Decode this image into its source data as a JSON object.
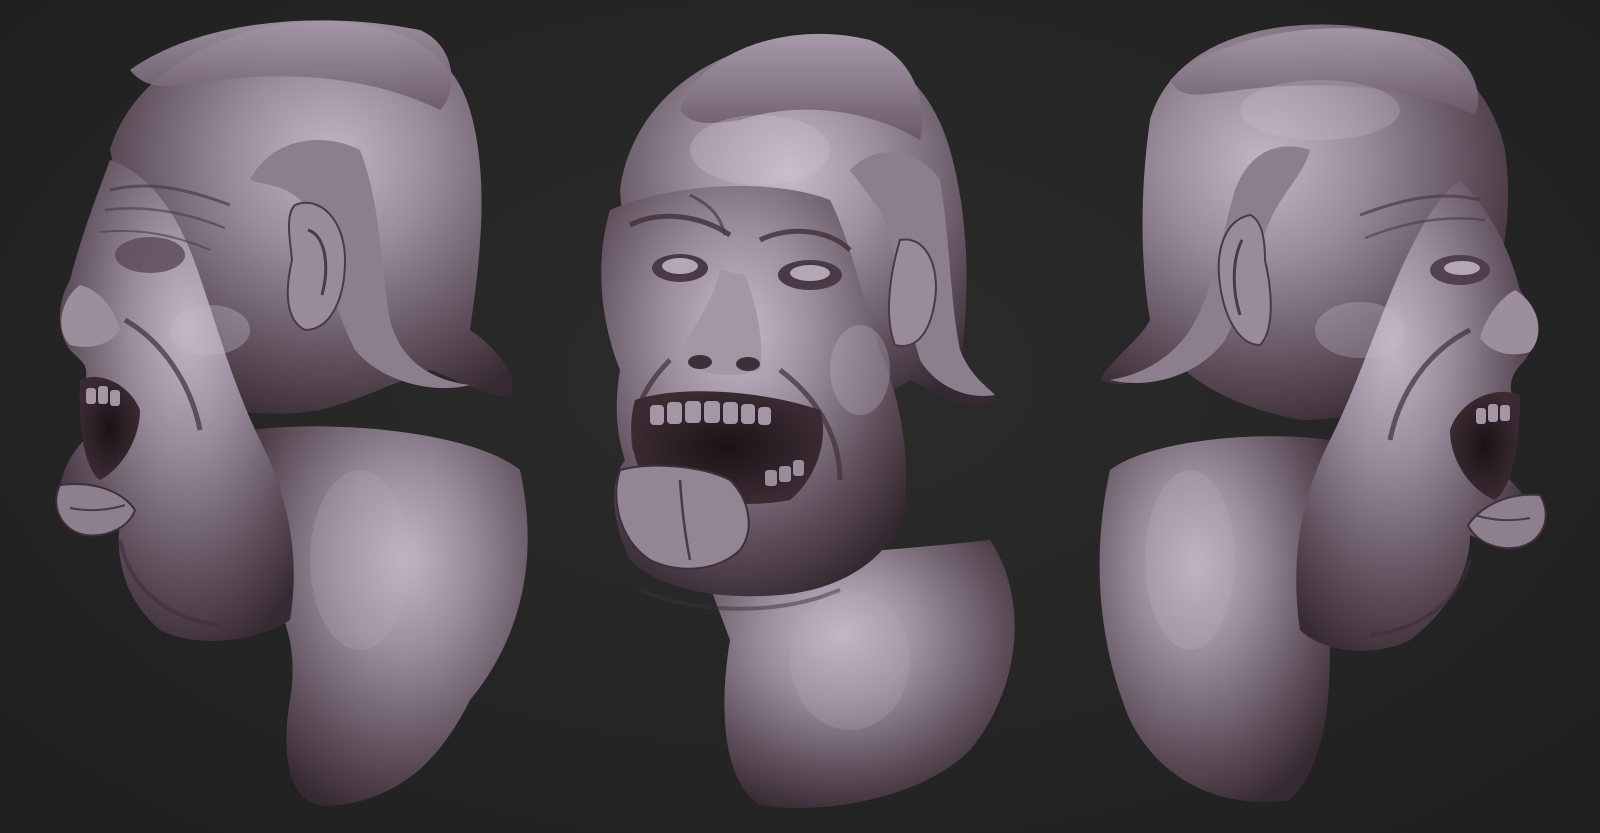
{
  "scene": {
    "background_color": "#262626",
    "clay_color": "#8a7a8a",
    "clay_highlight": "#c4b8c8",
    "clay_shadow": "#3e3038",
    "views": [
      {
        "id": "left-profile",
        "facing": "left"
      },
      {
        "id": "three-quarter-front",
        "facing": "front-left"
      },
      {
        "id": "right-profile",
        "facing": "right"
      }
    ]
  }
}
